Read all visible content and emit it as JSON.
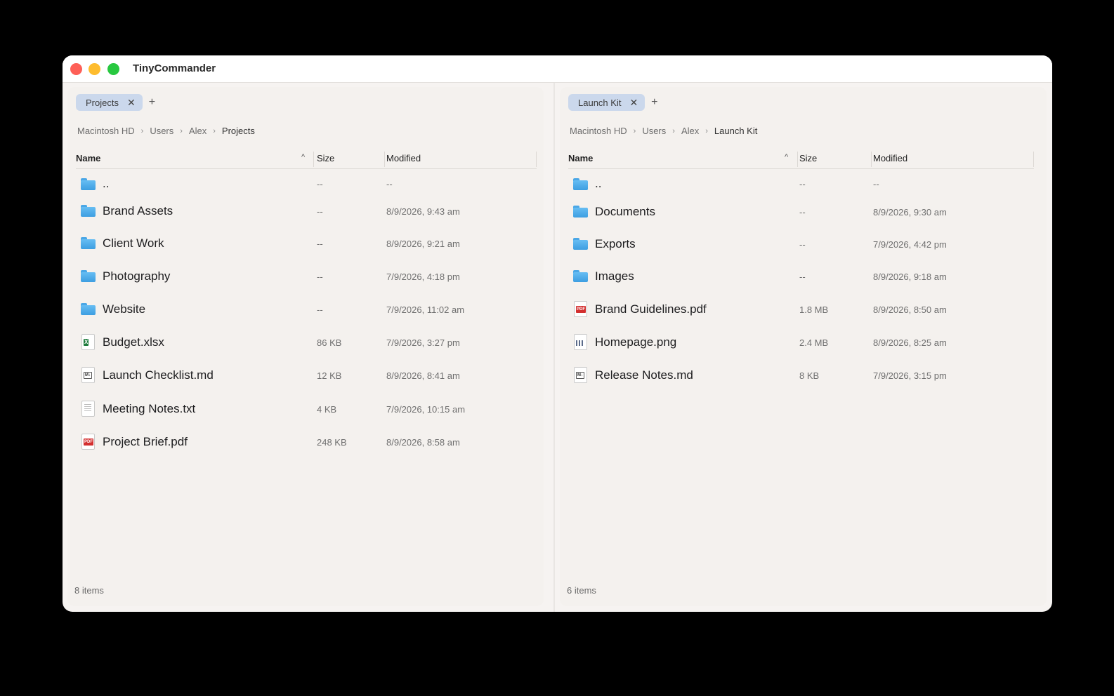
{
  "app": {
    "title": "TinyCommander"
  },
  "left": {
    "tab": {
      "label": "Projects",
      "close": "✕",
      "add": "+"
    },
    "breadcrumb": [
      "Macintosh HD",
      "Users",
      "Alex",
      "Projects"
    ],
    "columns": {
      "name": "Name",
      "size": "Size",
      "modified": "Modified",
      "sort_glyph": "^"
    },
    "rows": [
      {
        "name": "..",
        "size": "--",
        "modified": "--",
        "icon": "folder-icon"
      },
      {
        "name": "Brand Assets",
        "size": "--",
        "modified": "8/9/2026, 9:43 am",
        "icon": "folder-icon"
      },
      {
        "name": "Client Work",
        "size": "--",
        "modified": "8/9/2026, 9:21 am",
        "icon": "folder-icon"
      },
      {
        "name": "Photography",
        "size": "--",
        "modified": "7/9/2026, 4:18 pm",
        "icon": "folder-icon"
      },
      {
        "name": "Website",
        "size": "--",
        "modified": "7/9/2026, 11:02 am",
        "icon": "folder-icon"
      },
      {
        "name": "Budget.xlsx",
        "size": "86 KB",
        "modified": "7/9/2026, 3:27 pm",
        "icon": "excel-icon"
      },
      {
        "name": "Launch Checklist.md",
        "size": "12 KB",
        "modified": "8/9/2026, 8:41 am",
        "icon": "markdown-icon"
      },
      {
        "name": "Meeting Notes.txt",
        "size": "4 KB",
        "modified": "7/9/2026, 10:15 am",
        "icon": "text-file-icon"
      },
      {
        "name": "Project Brief.pdf",
        "size": "248 KB",
        "modified": "8/9/2026, 8:58 am",
        "icon": "pdf-icon"
      }
    ],
    "footer": "8 items"
  },
  "right": {
    "tab": {
      "label": "Launch Kit",
      "close": "✕",
      "add": "+"
    },
    "breadcrumb": [
      "Macintosh HD",
      "Users",
      "Alex",
      "Launch Kit"
    ],
    "columns": {
      "name": "Name",
      "size": "Size",
      "modified": "Modified",
      "sort_glyph": "^"
    },
    "rows": [
      {
        "name": "..",
        "size": "--",
        "modified": "--",
        "icon": "folder-icon"
      },
      {
        "name": "Documents",
        "size": "--",
        "modified": "8/9/2026, 9:30 am",
        "icon": "folder-icon"
      },
      {
        "name": "Exports",
        "size": "--",
        "modified": "7/9/2026, 4:42 pm",
        "icon": "folder-icon"
      },
      {
        "name": "Images",
        "size": "--",
        "modified": "8/9/2026, 9:18 am",
        "icon": "folder-icon"
      },
      {
        "name": "Brand Guidelines.pdf",
        "size": "1.8 MB",
        "modified": "8/9/2026, 8:50 am",
        "icon": "pdf-icon"
      },
      {
        "name": "Homepage.png",
        "size": "2.4 MB",
        "modified": "8/9/2026, 8:25 am",
        "icon": "image-file-icon"
      },
      {
        "name": "Release Notes.md",
        "size": "8 KB",
        "modified": "7/9/2026, 3:15 pm",
        "icon": "markdown-icon"
      }
    ],
    "footer": "6 items"
  },
  "colors": {
    "accent_tab": "#cbd8ec",
    "folder": "#4aa7e6",
    "close": "#fe5f57",
    "minimize": "#febc2e",
    "zoom": "#28c840"
  }
}
